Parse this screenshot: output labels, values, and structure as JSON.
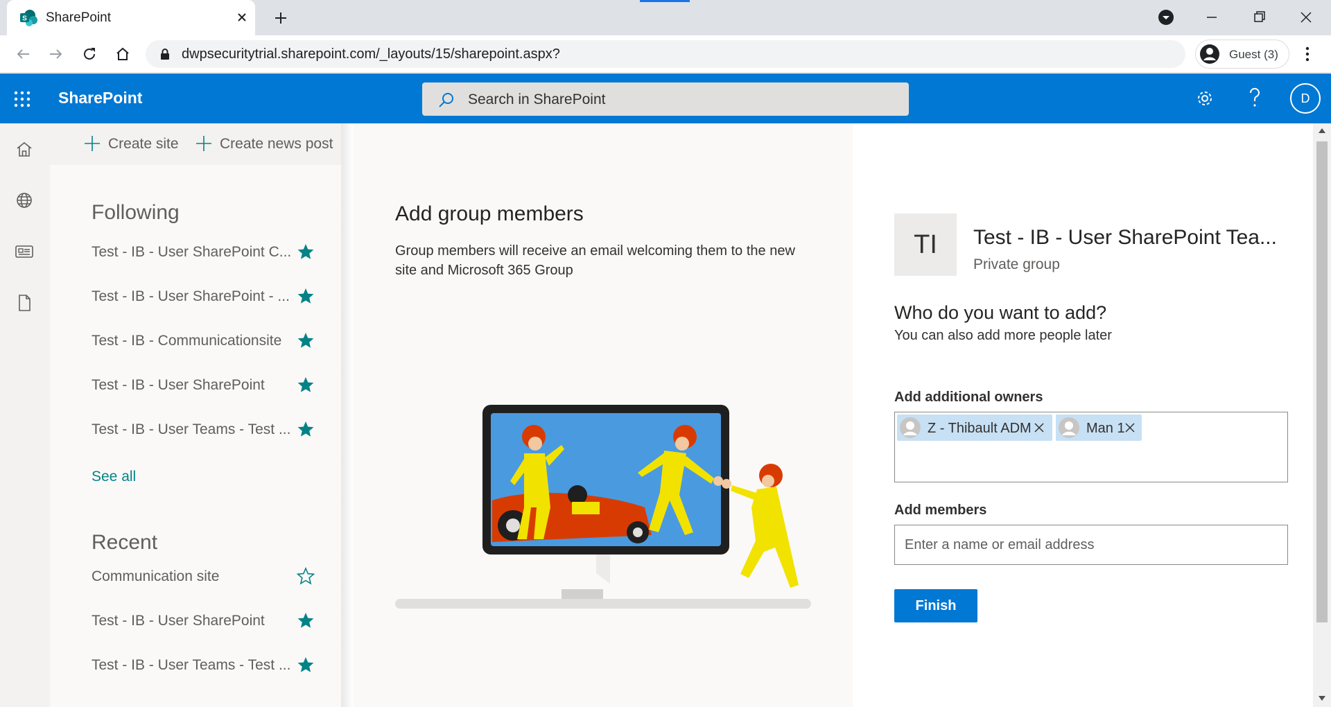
{
  "browser": {
    "tab_title": "SharePoint",
    "url": "dwpsecuritytrial.sharepoint.com/_layouts/15/sharepoint.aspx?",
    "profile_label": "Guest (3)"
  },
  "suite": {
    "brand": "SharePoint",
    "search_placeholder": "Search in SharePoint",
    "avatar_initial": "D"
  },
  "commands": {
    "create_site": "Create site",
    "create_news": "Create news post"
  },
  "following": {
    "heading": "Following",
    "items": [
      {
        "label": "Test - IB - User SharePoint C...",
        "starred": true
      },
      {
        "label": "Test - IB - User SharePoint - ...",
        "starred": true
      },
      {
        "label": "Test - IB - Communicationsite",
        "starred": true
      },
      {
        "label": "Test - IB - User SharePoint",
        "starred": true
      },
      {
        "label": "Test - IB - User Teams - Test ...",
        "starred": true
      }
    ],
    "see_all": "See all"
  },
  "recent": {
    "heading": "Recent",
    "items": [
      {
        "label": "Communication site",
        "starred": false
      },
      {
        "label": "Test - IB - User SharePoint",
        "starred": true
      },
      {
        "label": "Test - IB - User Teams - Test ...",
        "starred": true
      }
    ]
  },
  "panel": {
    "title": "Add group members",
    "description": "Group members will receive an email welcoming them to the new site and Microsoft 365 Group"
  },
  "group": {
    "initials": "TI",
    "name": "Test - IB - User SharePoint Tea...",
    "type": "Private group"
  },
  "form": {
    "who_heading": "Who do you want to add?",
    "who_sub": "You can also add more people later",
    "owners_label": "Add additional owners",
    "owners": [
      "Z - Thibault ADM",
      "Man 1"
    ],
    "members_label": "Add members",
    "members_placeholder": "Enter a name or email address",
    "finish": "Finish"
  },
  "colors": {
    "accent": "#0078d4",
    "star": "#038387",
    "chip": "#c7e0f4"
  },
  "icons": {
    "rail": [
      "home-icon",
      "globe-icon",
      "news-icon",
      "document-icon"
    ]
  }
}
